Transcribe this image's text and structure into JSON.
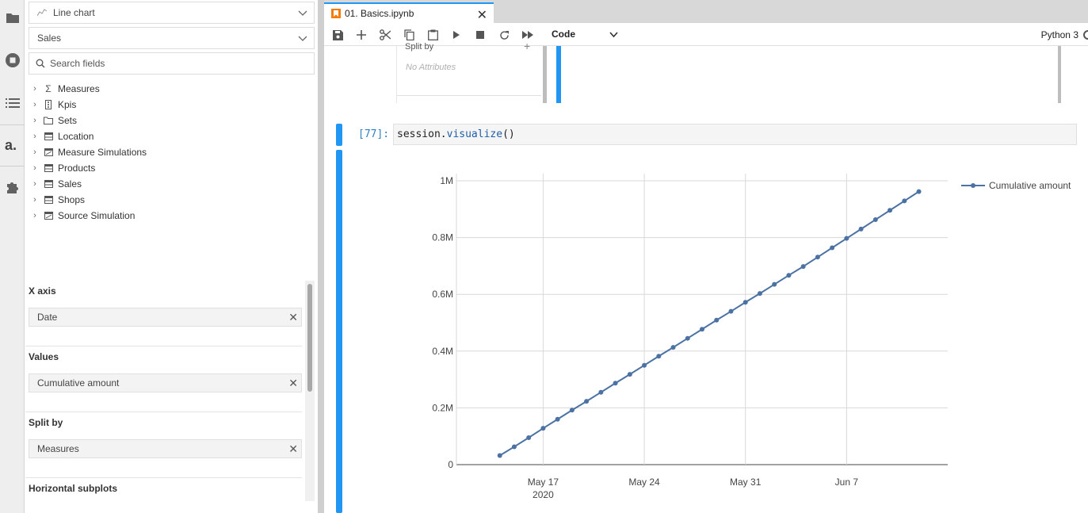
{
  "left_panel": {
    "chart_type": "Line chart",
    "cube": "Sales",
    "search": {
      "placeholder": "Search fields"
    },
    "tree": [
      {
        "label": "Measures",
        "icon": "sigma-icon"
      },
      {
        "label": "Kpis",
        "icon": "traffic-light-icon"
      },
      {
        "label": "Sets",
        "icon": "folder-icon"
      },
      {
        "label": "Location",
        "icon": "table-icon"
      },
      {
        "label": "Measure Simulations",
        "icon": "simulation-icon"
      },
      {
        "label": "Products",
        "icon": "table-icon"
      },
      {
        "label": "Sales",
        "icon": "table-icon"
      },
      {
        "label": "Shops",
        "icon": "table-icon"
      },
      {
        "label": "Source Simulation",
        "icon": "simulation-icon"
      }
    ],
    "x_axis": {
      "title": "X axis",
      "value": "Date"
    },
    "values": {
      "title": "Values",
      "value": "Cumulative amount"
    },
    "split_by": {
      "title": "Split by",
      "value": "Measures"
    },
    "horizontal_subplots": {
      "title": "Horizontal subplots"
    }
  },
  "tab": {
    "title": "01. Basics.ipynb"
  },
  "toolbar": {
    "cell_type": "Code",
    "kernel": "Python 3"
  },
  "previous_output": {
    "split_by": "Split by",
    "no_attributes": "No Attributes"
  },
  "cell": {
    "prompt": "[77]:",
    "code_obj": "session.",
    "code_fn": "visualize",
    "code_tail": "()"
  },
  "colors": {
    "accent": "#2196f3",
    "line": "#4c72a4"
  },
  "chart_data": {
    "type": "line",
    "title": "",
    "xlabel": "",
    "ylabel": "",
    "ylim": [
      0,
      1000000
    ],
    "yticks": [
      {
        "value": 0,
        "label": "0"
      },
      {
        "value": 200000,
        "label": "0.2M"
      },
      {
        "value": 400000,
        "label": "0.4M"
      },
      {
        "value": 600000,
        "label": "0.6M"
      },
      {
        "value": 800000,
        "label": "0.8M"
      },
      {
        "value": 1000000,
        "label": "1M"
      }
    ],
    "xticks": [
      {
        "date": "2020-05-17",
        "label": "May 17",
        "sublabel": "2020"
      },
      {
        "date": "2020-05-24",
        "label": "May 24",
        "sublabel": ""
      },
      {
        "date": "2020-05-31",
        "label": "May 31",
        "sublabel": ""
      },
      {
        "date": "2020-06-07",
        "label": "Jun 7",
        "sublabel": ""
      }
    ],
    "xlim": [
      "2020-05-11",
      "2020-06-14"
    ],
    "legend_position": "top-right",
    "grid": true,
    "series": [
      {
        "name": "Cumulative amount",
        "x": [
          "2020-05-14",
          "2020-05-15",
          "2020-05-16",
          "2020-05-17",
          "2020-05-18",
          "2020-05-19",
          "2020-05-20",
          "2020-05-21",
          "2020-05-22",
          "2020-05-23",
          "2020-05-24",
          "2020-05-25",
          "2020-05-26",
          "2020-05-27",
          "2020-05-28",
          "2020-05-29",
          "2020-05-30",
          "2020-05-31",
          "2020-06-01",
          "2020-06-02",
          "2020-06-03",
          "2020-06-04",
          "2020-06-05",
          "2020-06-06",
          "2020-06-07",
          "2020-06-08",
          "2020-06-09",
          "2020-06-10",
          "2020-06-11",
          "2020-06-12"
        ],
        "y": [
          32000,
          63000,
          95000,
          128000,
          160000,
          192000,
          223000,
          255000,
          287000,
          318000,
          350000,
          382000,
          413000,
          445000,
          477000,
          509000,
          540000,
          572000,
          603000,
          635000,
          667000,
          698000,
          731000,
          764000,
          797000,
          830000,
          863000,
          896000,
          929000,
          962000
        ]
      }
    ]
  }
}
